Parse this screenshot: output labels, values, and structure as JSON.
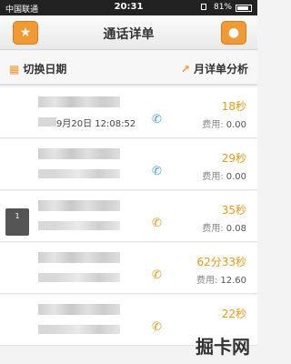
{
  "status": {
    "carrier": "中国联通",
    "time": "20:31",
    "battery": "81%"
  },
  "nav": {
    "title": "通话详单",
    "left_icon": "star-icon",
    "right_icon": "person-icon"
  },
  "toolbar": {
    "switch_date": "切换日期",
    "monthly_analysis": "月详单分析"
  },
  "fee_label": "费用:",
  "calls": [
    {
      "date": "9月20日",
      "time": "12:08:52",
      "direction": "incoming",
      "duration": "18秒",
      "fee": "0.00"
    },
    {
      "date": "",
      "time": "",
      "direction": "incoming",
      "duration": "29秒",
      "fee": "0.00"
    },
    {
      "date": "",
      "time": "",
      "direction": "outgoing",
      "duration": "35秒",
      "fee": "0.08"
    },
    {
      "date": "",
      "time": "",
      "direction": "outgoing",
      "duration": "62分33秒",
      "fee": "12.60"
    },
    {
      "date": "",
      "time": "",
      "direction": "outgoing",
      "duration": "22秒",
      "fee": ""
    }
  ],
  "badge_text": "1",
  "watermark": "掘卡网"
}
